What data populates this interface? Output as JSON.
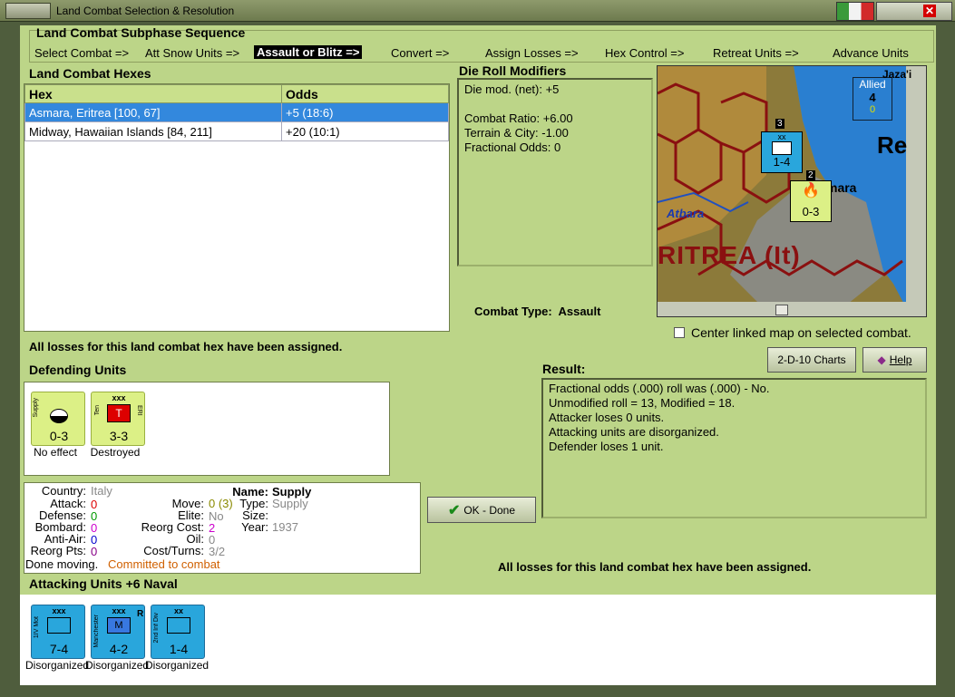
{
  "window": {
    "title": "Land Combat Selection & Resolution"
  },
  "subphase": {
    "heading": "Land Combat Subphase Sequence",
    "steps": [
      "Select Combat =>",
      "Att Snow Units =>",
      "Assault or Blitz =>",
      "Convert =>",
      "Assign Losses =>",
      "Hex Control =>",
      "Retreat Units =>",
      "Advance Units"
    ]
  },
  "hexes": {
    "heading": "Land Combat Hexes",
    "col_hex": "Hex",
    "col_odds": "Odds",
    "rows": [
      {
        "hex": "Asmara, Eritrea [100, 67]",
        "odds": "+5 (18:6)"
      },
      {
        "hex": "Midway, Hawaiian Islands [84, 211]",
        "odds": "+20 (10:1)"
      }
    ]
  },
  "modifiers": {
    "heading": "Die Roll Modifiers",
    "lines": [
      "Die mod. (net): +5",
      "",
      "Combat Ratio: +6.00",
      "Terrain & City: -1.00",
      "Fractional Odds: 0"
    ]
  },
  "combat_type": {
    "label": "Combat Type:",
    "value": "Assault"
  },
  "map": {
    "allied_label": "Allied",
    "allied_top": "4",
    "allied_bottom": "0",
    "place1": "Jaza'i",
    "place2": "Re",
    "place3": "mara",
    "river": "Atbara",
    "region": "RITREA (It)",
    "stack3": "3",
    "stack2": "2",
    "unit_a_val": "1-4",
    "unit_a_size": "xx",
    "unit_b_val": "0-3",
    "center_label": "Center linked map on selected combat."
  },
  "losses_msg": "All losses for this land combat hex have been assigned.",
  "defending": {
    "heading": "Defending Units",
    "units": [
      {
        "side": "Supply",
        "value": "0-3",
        "caption": "No effect"
      },
      {
        "side": "Ten",
        "side2": "ERI",
        "size": "xxx",
        "letter": "T",
        "value": "3-3",
        "caption": "Destroyed"
      }
    ]
  },
  "buttons": {
    "charts": "2-D-10 Charts",
    "help": "Help",
    "ok": "OK - Done"
  },
  "result": {
    "heading": "Result:",
    "lines": [
      "Fractional odds (.000) roll was (.000)  - No.",
      "Unmodified roll = 13, Modified = 18.",
      "Attacker loses 0 units.",
      "Attacking units are disorganized.",
      "Defender loses 1 unit."
    ]
  },
  "info": {
    "country_l": "Country:",
    "country_v": "Italy",
    "attack_l": "Attack:",
    "attack_v": "0",
    "defense_l": "Defense:",
    "defense_v": "0",
    "bombard_l": "Bombard:",
    "bombard_v": "0",
    "antiair_l": "Anti-Air:",
    "antiair_v": "0",
    "reorg_l": "Reorg Pts:",
    "reorg_v": "0",
    "move_l": "Move:",
    "move_v": "0 (3)",
    "elite_l": "Elite:",
    "elite_v": "No",
    "reorgcost_l": "Reorg Cost:",
    "reorgcost_v": "2",
    "oil_l": "Oil:",
    "oil_v": "0",
    "cost_l": "Cost/Turns:",
    "cost_v": "3/2",
    "name_l": "Name:",
    "name_v": "Supply",
    "type_l": "Type:",
    "type_v": "Supply",
    "size_l": "Size:",
    "size_v": "",
    "year_l": "Year:",
    "year_v": "1937",
    "done": "Done moving.",
    "committed": "Committed to combat"
  },
  "losses_msg2": "All losses for this land combat hex have been assigned.",
  "attacking": {
    "heading": "Attacking Units +6 Naval",
    "units": [
      {
        "side": "1IV Mot",
        "size": "xxx",
        "value": "7-4",
        "caption": "Disorganized"
      },
      {
        "side": "Manchester",
        "size": "xxx",
        "letter": "M",
        "flag": "R",
        "value": "4-2",
        "caption": "Disorganized"
      },
      {
        "side": "2nd Inf Div",
        "size": "xx",
        "value": "1-4",
        "caption": "Disorganized"
      }
    ]
  },
  "colors": {
    "panel": "#bcd588",
    "selected": "#3388dd",
    "attacker": "#29a6dc",
    "defender": "#dcf086"
  }
}
